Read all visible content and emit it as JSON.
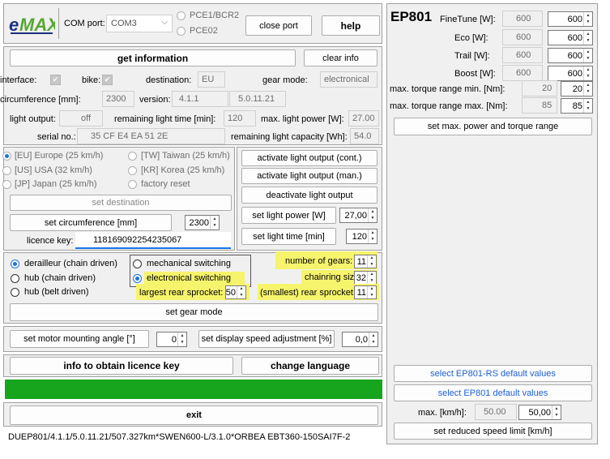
{
  "header": {
    "logo_text": "eMAX",
    "com_port_label": "COM port:",
    "com_port_value": "COM3",
    "radio_pce1": "PCE1/BCR2",
    "radio_pce2": "PCE02",
    "close_port": "close port",
    "help": "help"
  },
  "info": {
    "get_information": "get information",
    "clear_info": "clear info",
    "interface_label": "interface:",
    "bike_label": "bike:",
    "destination_label": "destination:",
    "destination_value": "EU",
    "gear_mode_label": "gear mode:",
    "gear_mode_value": "electronical",
    "circumference_label": "circumference [mm]:",
    "circumference_value": "2300",
    "version_label": "version:",
    "version_value": "4.1.1",
    "version_value2": "5.0.11.21",
    "light_output_label": "light output:",
    "light_output_value": "off",
    "remaining_light_time_label": "remaining light time [min]:",
    "remaining_light_time_value": "120",
    "max_light_power_label": "max. light power [W]:",
    "max_light_power_value": "27.00",
    "serial_label": "serial no.:",
    "serial_value": "35 CF E4 EA 51 2E",
    "remaining_light_capacity_label": "remaining light capacity [Wh]:",
    "remaining_light_capacity_value": "54.0"
  },
  "destination": {
    "eu": "[EU] Europe (25 km/h)",
    "tw": "[TW] Taiwan (25 km/h)",
    "us": "[US] USA (32 km/h)",
    "kr": "[KR] Korea (25 km/h)",
    "jp": "[JP] Japan (25 km/h)",
    "factory": "factory reset",
    "set_destination": "set destination",
    "set_circumference": "set circumference [mm]",
    "circumference_input": "2300",
    "licence_key_label": "licence key:",
    "licence_key_value": "118169092254235067"
  },
  "light": {
    "activate_cont": "activate light output (cont.)",
    "activate_man": "activate light output (man.)",
    "deactivate": "deactivate light output",
    "set_power": "set light power [W]",
    "power_value": "27,00",
    "set_time": "set light time [min]",
    "time_value": "120"
  },
  "gear": {
    "derailleur": "derailleur (chain driven)",
    "hub_chain": "hub (chain driven)",
    "hub_belt": "hub (belt driven)",
    "mechanical": "mechanical switching",
    "electronical": "electronical switching",
    "largest_rear_label": "largest rear sprocket:",
    "largest_rear_value": "50",
    "number_of_gears_label": "number of gears:",
    "number_of_gears_value": "11",
    "chainring_label": "chainring size:",
    "chainring_value": "32",
    "smallest_rear_label": "(smallest) rear sprocket:",
    "smallest_rear_value": "11",
    "set_gear_mode": "set gear mode",
    "highlight_color": "#f6f46c"
  },
  "motor": {
    "set_angle": "set motor mounting angle [°]",
    "angle_value": "0",
    "set_display_speed": "set display speed adjustment [%]",
    "display_speed_value": "0,0"
  },
  "actions": {
    "licence_info": "info to obtain licence key",
    "change_language": "change language",
    "exit": "exit",
    "status_bar_color": "#16a51d"
  },
  "status_line": "DUEP801/4.1.1/5.0.11.21/507.327km*SWEN600-L/3.1.0*ORBEA EBT360-150SAI7F-2",
  "ep801": {
    "title": "EP801",
    "finetune_label": "FineTune [W]:",
    "finetune_current": "600",
    "finetune_value": "600",
    "eco_label": "Eco [W]:",
    "eco_current": "600",
    "eco_value": "600",
    "trail_label": "Trail [W]:",
    "trail_current": "600",
    "trail_value": "600",
    "boost_label": "Boost [W]:",
    "boost_current": "600",
    "boost_value": "600",
    "torque_min_label": "max. torque range min. [Nm]:",
    "torque_min_current": "20",
    "torque_min_value": "20",
    "torque_max_label": "max. torque range max. [Nm]:",
    "torque_max_current": "85",
    "torque_max_value": "85",
    "set_power_torque": "set max. power and torque range",
    "select_rs_defaults": "select EP801-RS default values",
    "select_defaults": "select EP801 default values",
    "max_kmh_label": "max. [km/h]:",
    "max_kmh_current": "50.00",
    "max_kmh_value": "50,00",
    "set_reduced_speed": "set reduced speed limit [km/h]"
  }
}
